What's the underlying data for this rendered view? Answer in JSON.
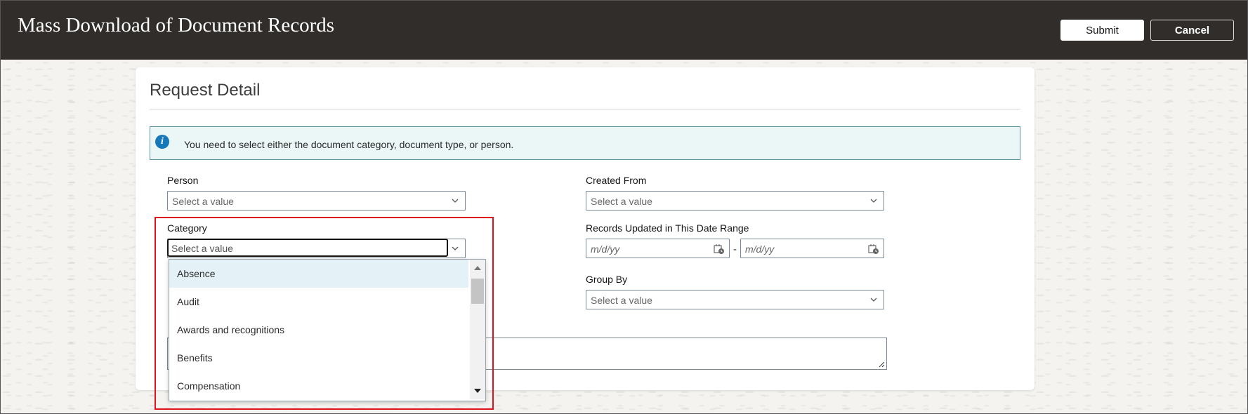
{
  "header": {
    "title": "Mass Download of Document Records",
    "submit_label": "Submit",
    "cancel_label": "Cancel"
  },
  "section": {
    "title": "Request Detail",
    "info_message": "You need to select either the document category, document type, or person."
  },
  "fields": {
    "person": {
      "label": "Person",
      "placeholder": "Select a value"
    },
    "category": {
      "label": "Category",
      "placeholder": "Select a value"
    },
    "created_from": {
      "label": "Created From",
      "placeholder": "Select a value"
    },
    "date_range": {
      "label": "Records Updated in This Date Range",
      "start_placeholder": "m/d/yy",
      "end_placeholder": "m/d/yy",
      "separator": "-"
    },
    "group_by": {
      "label": "Group By",
      "placeholder": "Select a value"
    }
  },
  "category_dropdown": {
    "options": [
      "Absence",
      "Audit",
      "Awards and recognitions",
      "Benefits",
      "Compensation"
    ],
    "highlighted": "Absence"
  },
  "icons": {
    "info": "info-icon",
    "chevron": "chevron-down-icon",
    "calendar": "calendar-icon"
  },
  "colors": {
    "header_bg": "#312d2a",
    "info_bg": "#ebf6f6",
    "info_icon": "#1778b9",
    "highlight": "#e0121b"
  }
}
